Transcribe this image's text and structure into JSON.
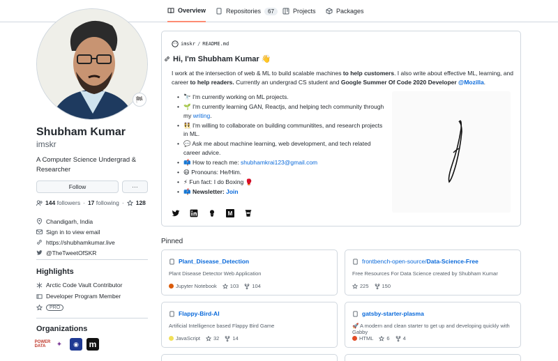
{
  "tabs": [
    {
      "label": "Overview",
      "icon": "book-icon",
      "active": true
    },
    {
      "label": "Repositories",
      "icon": "repo-icon",
      "count": "67"
    },
    {
      "label": "Projects",
      "icon": "project-icon"
    },
    {
      "label": "Packages",
      "icon": "package-icon"
    }
  ],
  "profile": {
    "name": "Shubham Kumar",
    "login": "imskr",
    "status_emoji": "🏁",
    "bio": "A Computer Science Undergrad & Researcher",
    "follow_label": "Follow",
    "more_label": "···",
    "followers_count": "144",
    "followers_label": "followers",
    "following_count": "17",
    "following_label": "following",
    "stars_count": "128",
    "location": "Chandigarh, India",
    "email": "Sign in to view email",
    "website": "https://shubhamkumar.live",
    "twitter": "@TheTweetOfSKR"
  },
  "highlights": {
    "heading": "Highlights",
    "items": [
      "Arctic Code Vault Contributor",
      "Developer Program Member",
      "PRO"
    ]
  },
  "organizations": {
    "heading": "Organizations",
    "items": [
      {
        "label": "POWER DATA",
        "color": "#c0392b"
      },
      {
        "label": "✦",
        "color": "#7d3c98"
      },
      {
        "label": "◉",
        "color": "#1f3a93"
      },
      {
        "label": "m",
        "color": "#111111"
      }
    ]
  },
  "readme": {
    "path_owner": "imskr",
    "path_file": "README.md",
    "heading": "Hi, I'm Shubham Kumar 👋",
    "intro_1": "I work at the intersection of web & ML to build scalable machines ",
    "intro_b1": "to help customers",
    "intro_2": ". I also write about effective ML, learning, and career ",
    "intro_b2": "to help readers.",
    "intro_3": " Currently an undergrad CS student and ",
    "intro_b3": "Google Summer Of Code 2020 Developer ",
    "intro_link": "@Mozilla",
    "intro_4": ".",
    "items": [
      {
        "emoji": "🔭",
        "text": "I'm currently working on ML projects."
      },
      {
        "emoji": "🌱",
        "text": "I'm currently learning GAN, Reactjs, and helping tech community through my ",
        "link": "writing",
        "after": "."
      },
      {
        "emoji": "👯",
        "text": "I'm willing to collaborate on building communitites, and research projects in ML."
      },
      {
        "emoji": "💬",
        "text": "Ask me about machine learning, web development, and tech related career advice."
      },
      {
        "emoji": "📫",
        "text": "How to reach me: ",
        "link": "shubhamkrai123@gmail.com"
      },
      {
        "emoji": "😄",
        "text": "Pronouns: He/Him."
      },
      {
        "emoji": "⚡",
        "text": "Fun fact: I do Boxing 🥊"
      },
      {
        "emoji": "📫",
        "bold": "Newsletter: ",
        "link": "Join"
      }
    ],
    "social_icons": [
      "twitter-icon",
      "linkedin-icon",
      "kaggle-icon",
      "medium-icon",
      "coffee-icon"
    ]
  },
  "pinned": {
    "heading": "Pinned",
    "cards": [
      {
        "owner": "",
        "repo": "Plant_Disease_Detection",
        "desc": "Plant Disease Detector Web Application",
        "lang": "Jupyter Notebook",
        "lang_color": "#DA5B0B",
        "stars": "103",
        "forks": "104"
      },
      {
        "owner": "frontbench-open-source/",
        "repo": "Data-Science-Free",
        "desc": "Free Resources For Data Science created by Shubham Kumar",
        "lang": "",
        "lang_color": "",
        "stars": "225",
        "forks": "150"
      },
      {
        "owner": "",
        "repo": "Flappy-Bird-AI",
        "desc": "Artificial Intelligence based Flappy Bird Game",
        "lang": "JavaScript",
        "lang_color": "#f1e05a",
        "stars": "32",
        "forks": "14"
      },
      {
        "owner": "",
        "repo": "gatsby-starter-plasma",
        "desc": "🚀 A modern and clean starter to get up and developing quickly with Gabby",
        "lang": "HTML",
        "lang_color": "#e34c26",
        "stars": "6",
        "forks": "4"
      }
    ]
  }
}
